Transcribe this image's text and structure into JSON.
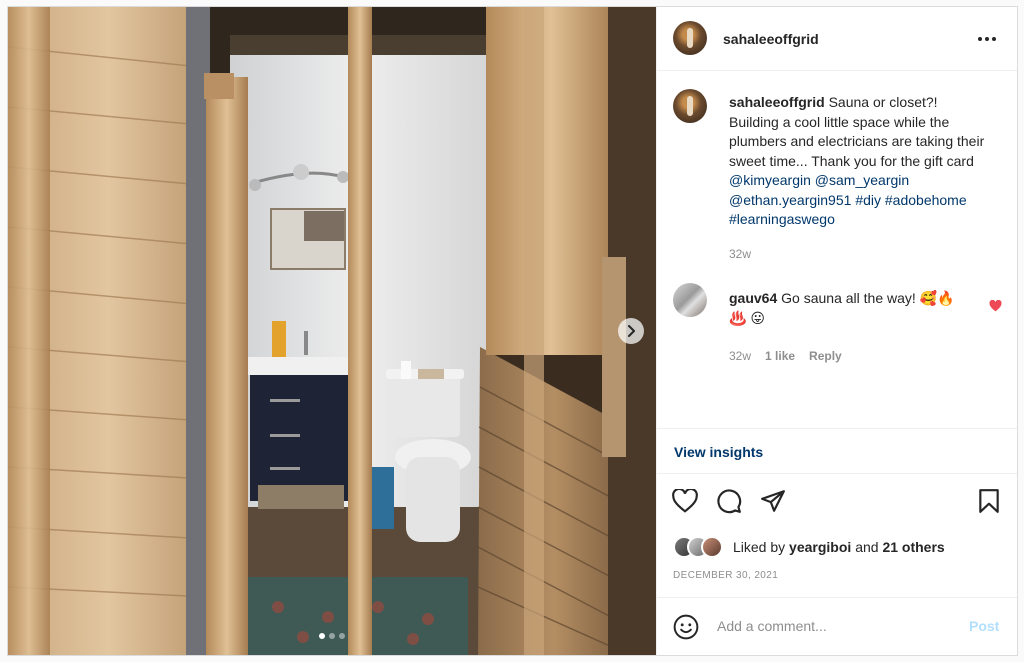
{
  "post": {
    "username": "sahaleeoffgrid",
    "caption": {
      "username": "sahaleeoffgrid",
      "text": "Sauna or closet?! Building a cool little space while the plumbers and electricians are taking their sweet time... Thank you for the gift card",
      "mentions": [
        "@kimyeargin",
        "@sam_yeargin",
        "@ethan.yeargin951",
        "#diy",
        "#adobehome",
        "#learningaswego"
      ],
      "time": "32w"
    },
    "comment": {
      "username": "gauv64",
      "text": "Go sauna all the way!",
      "emojis": [
        "🥰",
        "🔥",
        "♨️",
        "😛"
      ],
      "time": "32w",
      "likes": "1 like",
      "reply_label": "Reply"
    },
    "insights_label": "View insights",
    "likes": {
      "prefix": "Liked by",
      "user": "yeargiboi",
      "middle": "and",
      "others": "21 others"
    },
    "date": "DECEMBER 30, 2021",
    "add_comment": {
      "placeholder": "Add a comment...",
      "post_label": "Post"
    },
    "carousel": {
      "count": 3,
      "active": 1
    }
  },
  "icons": {
    "more": "more-horizontal-icon",
    "like": "heart-icon",
    "comment": "comment-icon",
    "share": "paper-plane-icon",
    "save": "bookmark-icon",
    "emoji": "smiley-icon",
    "next": "chevron-right-icon"
  },
  "colors": {
    "link": "#00376b",
    "muted": "#8e8e8e",
    "post_disabled": "#b2dffc",
    "heart_red": "#ed4956"
  }
}
